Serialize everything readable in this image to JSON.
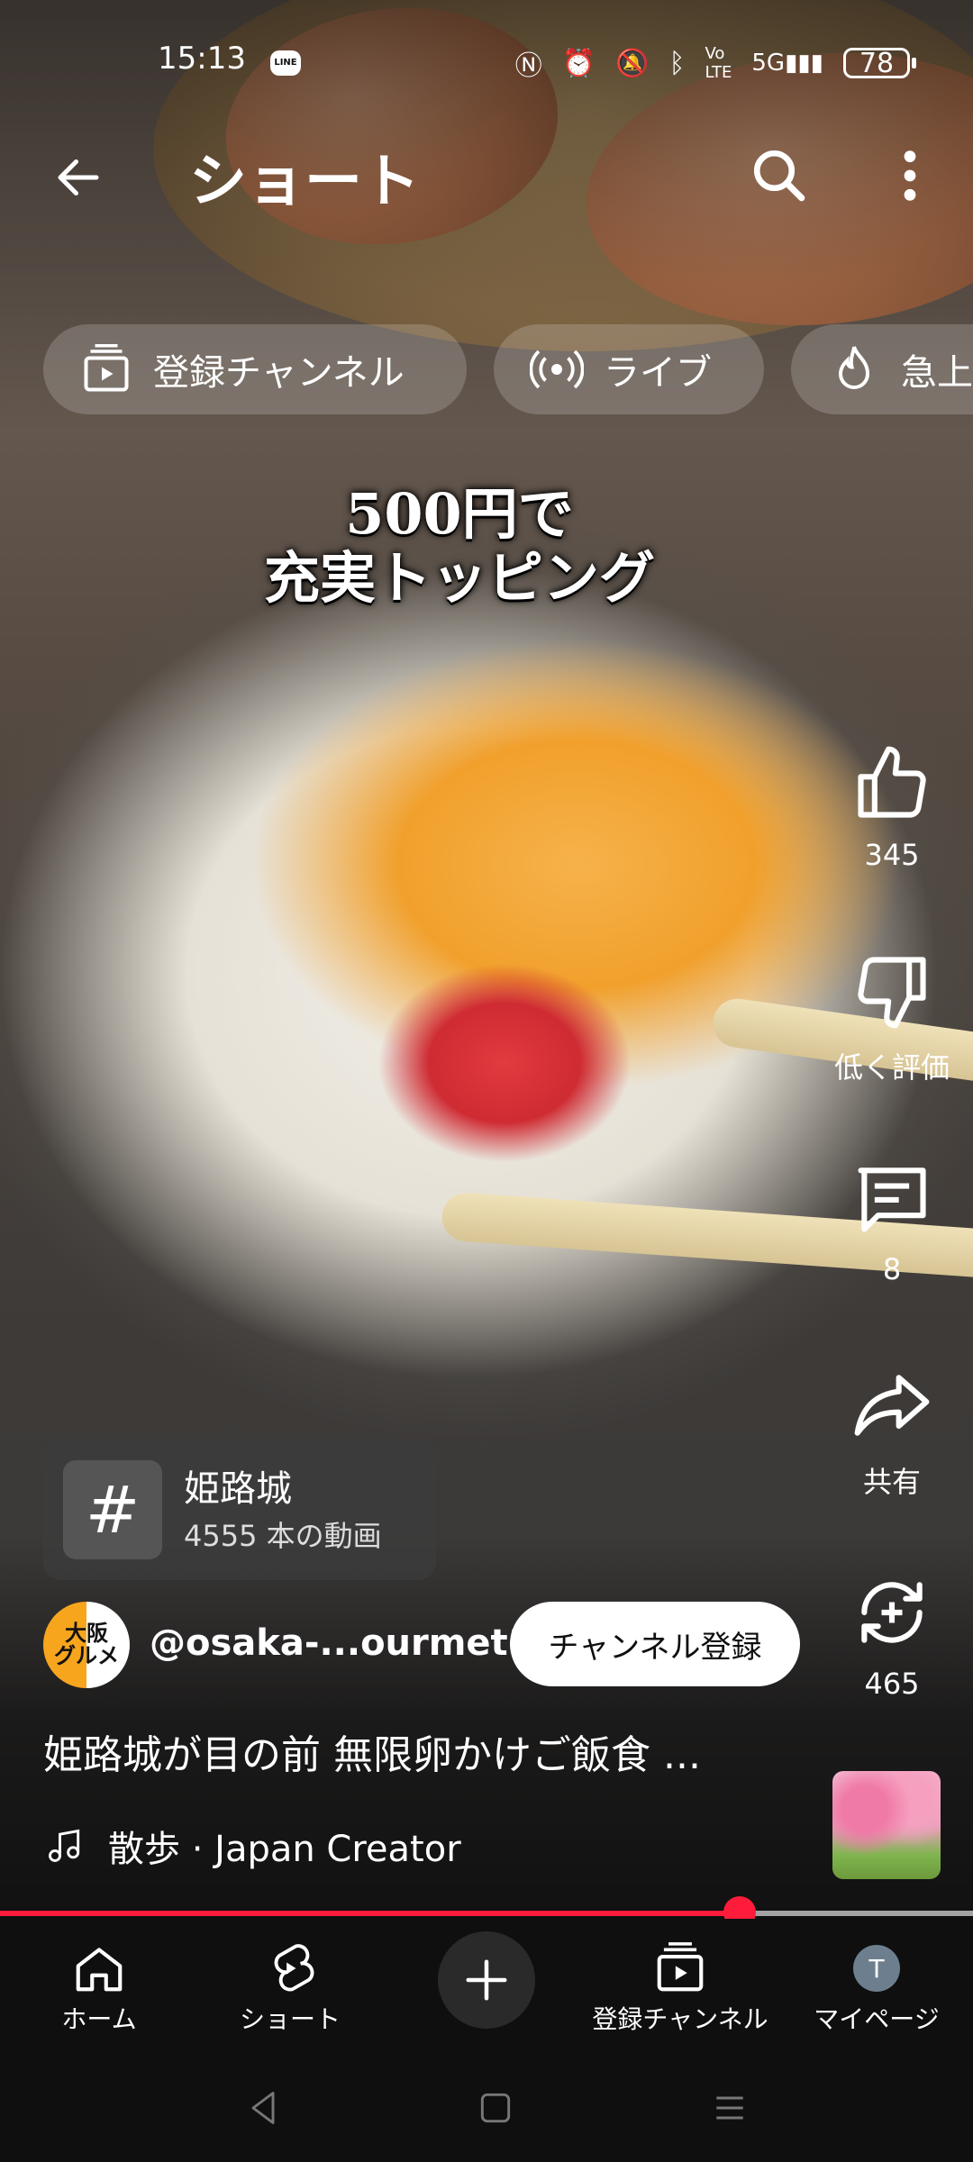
{
  "status_bar": {
    "time": "15:13",
    "line_app": "LINE",
    "battery": "78"
  },
  "header": {
    "title": "ショート"
  },
  "chips": [
    {
      "label": "登録チャンネル",
      "icon": "subscriptions-icon"
    },
    {
      "label": "ライブ",
      "icon": "live-icon"
    },
    {
      "label": "急上",
      "icon": "trending-icon"
    }
  ],
  "video_overlay": {
    "line1": "500円で",
    "line2": "充実トッピング"
  },
  "actions": {
    "like_count": "345",
    "dislike_label": "低く評価",
    "comment_count": "8",
    "share_label": "共有",
    "remix_count": "465"
  },
  "hashtag": {
    "symbol": "#",
    "title": "姫路城",
    "subtitle": "4555 本の動画"
  },
  "channel": {
    "avatar_line1": "大阪",
    "avatar_line2": "グルメ",
    "handle": "@osaka-...ourmet1",
    "subscribe_label": "チャンネル登録"
  },
  "video": {
    "title": "姫路城が目の前 無限卵かけご飯食 ..."
  },
  "music": {
    "text": "散歩 · Japan Creator"
  },
  "progress": {
    "played_fraction": 0.76
  },
  "bottom_nav": {
    "home": "ホーム",
    "shorts": "ショート",
    "subscriptions": "登録チャンネル",
    "you": "マイページ",
    "you_initial": "T"
  },
  "colors": {
    "accent_red": "#ff1c3a",
    "background": "#0f0f0f"
  }
}
